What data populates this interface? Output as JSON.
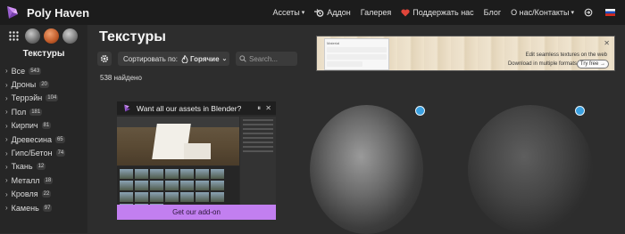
{
  "brand": {
    "name": "Poly Haven"
  },
  "nav": {
    "assets": "Ассеты",
    "addon": "Аддон",
    "gallery": "Галерея",
    "support": "Поддержать нас",
    "blog": "Блог",
    "about": "О нас/Контакты"
  },
  "sidebar": {
    "title": "Текстуры",
    "categories": [
      {
        "label": "Все",
        "count": "543"
      },
      {
        "label": "Дроны",
        "count": "20"
      },
      {
        "label": "Террэйн",
        "count": "104"
      },
      {
        "label": "Пол",
        "count": "181"
      },
      {
        "label": "Кирпич",
        "count": "81"
      },
      {
        "label": "Древесина",
        "count": "65"
      },
      {
        "label": "Гипс/Бетон",
        "count": "74"
      },
      {
        "label": "Ткань",
        "count": "12"
      },
      {
        "label": "Металл",
        "count": "18"
      },
      {
        "label": "Кровля",
        "count": "22"
      },
      {
        "label": "Камень",
        "count": "97"
      }
    ]
  },
  "main": {
    "title": "Текстуры",
    "sort_label": "Сортировать по:",
    "sort_value": "Горячие",
    "search_placeholder": "Search...",
    "found": "538 найдено"
  },
  "ad": {
    "mock_title": "Material",
    "line1": "Edit seamless textures on the web",
    "line2": "Download in multiple formats",
    "try": "Try free"
  },
  "blender_card": {
    "title": "Want all our assets in Blender?",
    "button": "Get our add-on"
  },
  "colors": {
    "accent_purple": "#c27ff0",
    "badge_blue": "#3aa0e0",
    "heart_red": "#e0453a"
  }
}
